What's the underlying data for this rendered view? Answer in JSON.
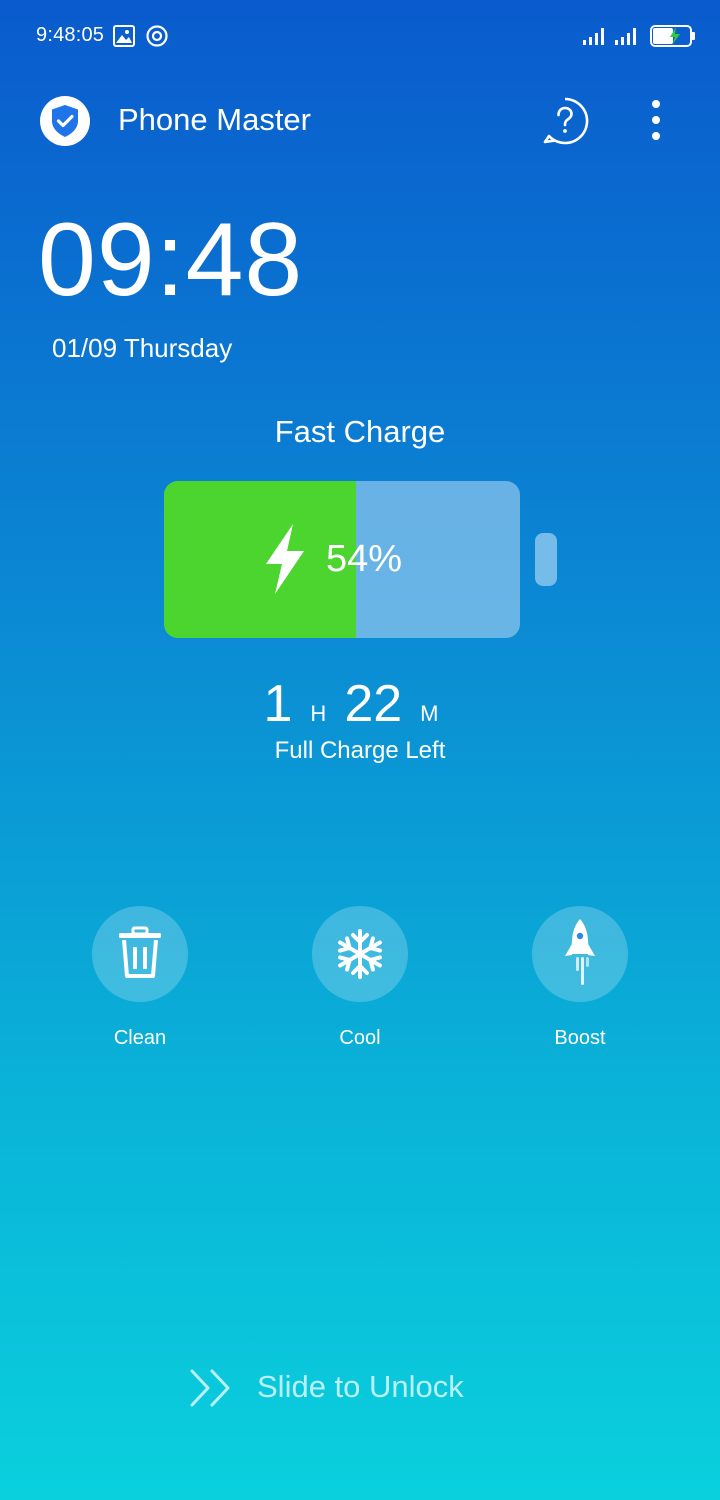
{
  "status_bar": {
    "time": "9:48:05",
    "icons": [
      "gallery-icon",
      "record-icon",
      "signal-icon",
      "signal-icon",
      "battery-charging-icon"
    ]
  },
  "app_bar": {
    "title": "Phone Master",
    "logo": "shield-check-icon",
    "help_icon": "help-icon",
    "more_icon": "more-vert-icon"
  },
  "clock": {
    "time": "09:48",
    "date": "01/09 Thursday"
  },
  "charge": {
    "mode": "Fast Charge",
    "percent_text": "54%",
    "level_percent": 54,
    "hours": "1",
    "hours_unit": "H",
    "minutes": "22",
    "minutes_unit": "M",
    "label": "Full Charge Left",
    "fill_color": "#4bd52e"
  },
  "actions": [
    {
      "label": "Clean",
      "icon": "trash-icon"
    },
    {
      "label": "Cool",
      "icon": "snowflake-icon"
    },
    {
      "label": "Boost",
      "icon": "rocket-icon"
    }
  ],
  "unlock": {
    "label": "Slide to Unlock",
    "icon": "double-chevron-right-icon"
  }
}
